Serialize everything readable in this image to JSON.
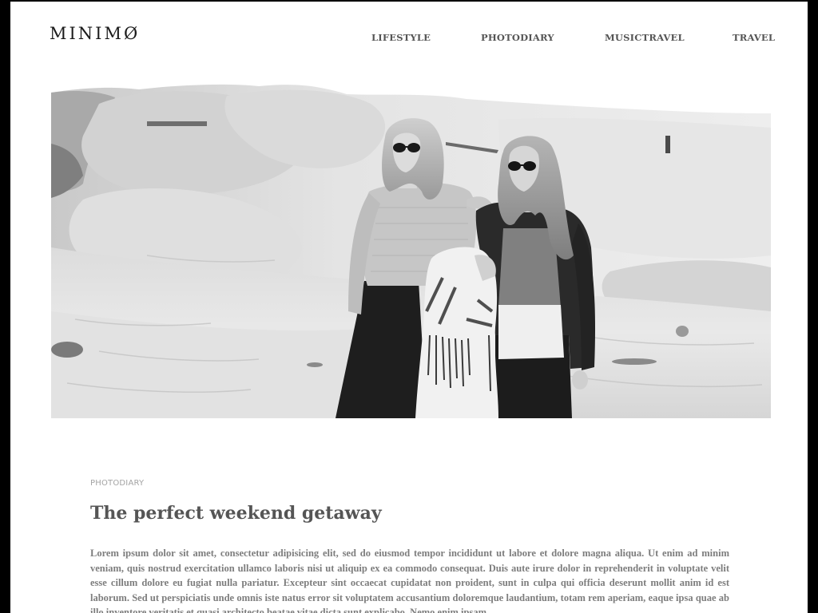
{
  "header": {
    "brand": "MINIMØ",
    "nav": [
      "LIFESTYLE",
      "PHOTODIARY",
      "MUSICTRAVEL",
      "TRAVEL"
    ]
  },
  "hero": {
    "subject": "Two women wearing sunglasses standing on pale sand dunes, black and white photograph"
  },
  "article": {
    "category": "PHOTODIARY",
    "title": "The perfect weekend getaway",
    "body": "Lorem ipsum dolor sit amet, consectetur adipisicing elit, sed do eiusmod tempor incididunt ut labore et dolore magna aliqua. Ut enim ad minim veniam, quis nostrud exercitation ullamco laboris nisi ut aliquip ex ea commodo consequat. Duis aute irure dolor in reprehenderit in voluptate velit esse cillum dolore eu fugiat nulla pariatur. Excepteur sint occaecat cupidatat non proident, sunt in culpa qui officia deserunt mollit anim id est laborum. Sed ut perspiciatis unde omnis iste natus error sit voluptatem accusantium doloremque laudantium, totam rem aperiam, eaque ipsa quae ab illo inventore veritatis et quasi architecto beatae vitae dicta sunt explicabo. Nemo enim ipsam"
  },
  "colors": {
    "page_background": "#ffffff",
    "frame": "#000000",
    "nav_text": "#555555",
    "title_text": "#555555",
    "body_text": "#7d7d7d",
    "category_text": "#a3a3a3"
  }
}
